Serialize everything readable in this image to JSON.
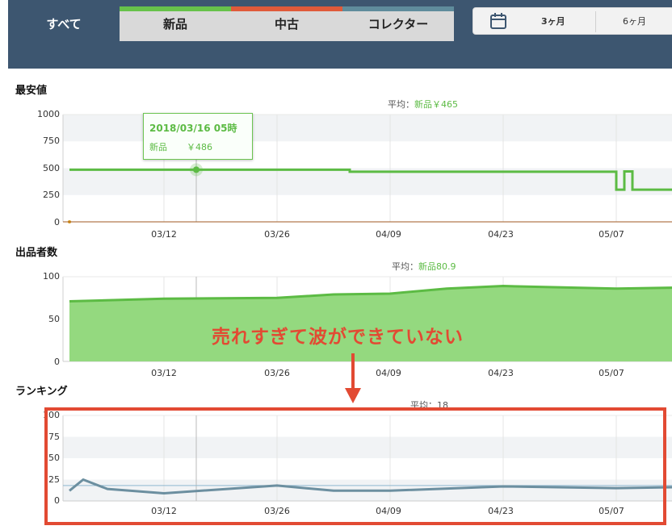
{
  "tabs": [
    {
      "label": "すべて",
      "active": true,
      "color": ""
    },
    {
      "label": "新品",
      "active": false,
      "color": "#67c24a"
    },
    {
      "label": "中古",
      "active": false,
      "color": "#e05a3a"
    },
    {
      "label": "コレクター",
      "active": false,
      "color": "#5f8c9c"
    }
  ],
  "period": {
    "options": [
      "3ヶ月",
      "6ヶ月"
    ],
    "selected": "3ヶ月",
    "icon": "calendar-icon"
  },
  "colors": {
    "header": "#3d5670",
    "new": "#5cbb44",
    "ranking": "#6c8fa0",
    "annotation": "#e24a33"
  },
  "x_labels": [
    "03/12",
    "03/26",
    "04/09",
    "04/23",
    "05/07"
  ],
  "sections": {
    "price": {
      "title": "最安値",
      "avg_label": "平均：",
      "avg_value": "新品￥465",
      "yticks": [
        "1000",
        "750",
        "500",
        "250",
        "0"
      ],
      "tooltip": {
        "date": "2018/03/16 05時",
        "series": "新品",
        "value": "￥486"
      }
    },
    "sellers": {
      "title": "出品者数",
      "avg_label": "平均：",
      "avg_value": "新品80.9",
      "yticks": [
        "100",
        "50",
        "0"
      ]
    },
    "ranking": {
      "title": "ランキング",
      "avg_label": "平均：",
      "avg_value": "18",
      "yticks": [
        "100",
        "75",
        "50",
        "25",
        "0"
      ]
    }
  },
  "annotation": "売れすぎて波ができていない",
  "chart_data": [
    {
      "type": "line",
      "title": "最安値",
      "series": [
        {
          "name": "新品",
          "points": [
            [
              "03/01",
              486
            ],
            [
              "03/30",
              486
            ],
            [
              "04/04",
              467
            ],
            [
              "05/07",
              467
            ],
            [
              "05/07",
              300
            ],
            [
              "05/08",
              470
            ],
            [
              "05/09",
              300
            ],
            [
              "05/16",
              300
            ]
          ]
        }
      ],
      "ylim": [
        0,
        1000
      ],
      "average": 465
    },
    {
      "type": "area",
      "title": "出品者数",
      "series": [
        {
          "name": "新品",
          "points": [
            [
              "03/01",
              71
            ],
            [
              "03/12",
              74
            ],
            [
              "03/26",
              75
            ],
            [
              "04/02",
              79
            ],
            [
              "04/09",
              80
            ],
            [
              "04/16",
              86
            ],
            [
              "04/23",
              89
            ],
            [
              "05/07",
              86
            ],
            [
              "05/16",
              87
            ]
          ]
        }
      ],
      "ylim": [
        0,
        100
      ],
      "average": 80.9
    },
    {
      "type": "line",
      "title": "ランキング",
      "series": [
        {
          "name": "",
          "points": [
            [
              "03/01",
              12
            ],
            [
              "03/02",
              25
            ],
            [
              "03/05",
              14
            ],
            [
              "03/12",
              9
            ],
            [
              "03/26",
              18
            ],
            [
              "04/02",
              12
            ],
            [
              "04/09",
              12
            ],
            [
              "04/23",
              17
            ],
            [
              "05/07",
              15
            ],
            [
              "05/16",
              16
            ]
          ]
        }
      ],
      "ylim": [
        0,
        100
      ],
      "average": 18
    }
  ]
}
